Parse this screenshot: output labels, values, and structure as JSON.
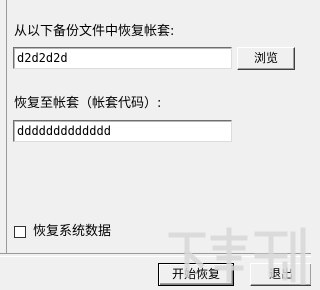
{
  "restore": {
    "source_label": "从以下备份文件中恢复帐套:",
    "source_value": "d2d2d2d",
    "browse_label": "浏览",
    "target_label": "恢复至帐套（帐套代码）:",
    "target_value": "ddddddddddddd",
    "restore_system_data_label": "恢复系统数据",
    "restore_system_data_checked": false,
    "start_label": "开始恢复",
    "exit_label": "退出"
  },
  "watermark": {
    "icon": "download-site-logo-watermark"
  }
}
